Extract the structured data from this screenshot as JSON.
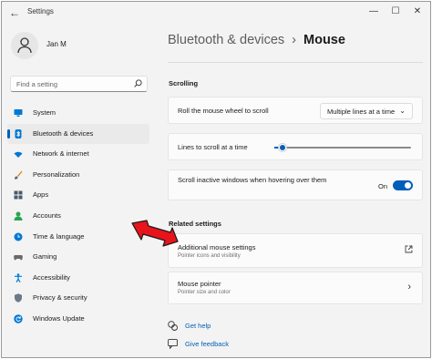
{
  "window": {
    "title": "Settings",
    "controls": {
      "minimize": "—",
      "maximize": "☐",
      "close": "✕"
    }
  },
  "user": {
    "name": "Jan M"
  },
  "search": {
    "placeholder": "Find a setting"
  },
  "sidebar": {
    "items": [
      {
        "label": "System",
        "icon": "monitor-icon",
        "color": "#0078d4",
        "active": false
      },
      {
        "label": "Bluetooth & devices",
        "icon": "bluetooth-icon",
        "color": "#0078d4",
        "active": true
      },
      {
        "label": "Network & internet",
        "icon": "wifi-icon",
        "color": "#0078d4",
        "active": false
      },
      {
        "label": "Personalization",
        "icon": "paintbrush-icon",
        "color": "#e08a2a",
        "active": false
      },
      {
        "label": "Apps",
        "icon": "apps-icon",
        "color": "#4a5a6a",
        "active": false
      },
      {
        "label": "Accounts",
        "icon": "person-icon",
        "color": "#2aa44f",
        "active": false
      },
      {
        "label": "Time & language",
        "icon": "globe-clock-icon",
        "color": "#0078d4",
        "active": false
      },
      {
        "label": "Gaming",
        "icon": "gamepad-icon",
        "color": "#6a6a6a",
        "active": false
      },
      {
        "label": "Accessibility",
        "icon": "accessibility-icon",
        "color": "#0078d4",
        "active": false
      },
      {
        "label": "Privacy & security",
        "icon": "shield-icon",
        "color": "#6a7a8a",
        "active": false
      },
      {
        "label": "Windows Update",
        "icon": "update-icon",
        "color": "#0078d4",
        "active": false
      }
    ]
  },
  "breadcrumb": {
    "parent": "Bluetooth & devices",
    "separator": "›",
    "current": "Mouse"
  },
  "scrolling": {
    "heading": "Scrolling",
    "roll_label": "Roll the mouse wheel to scroll",
    "roll_value": "Multiple lines at a time",
    "lines_label": "Lines to scroll at a time",
    "lines_slider_fraction": 0.06,
    "inactive_label": "Scroll inactive windows when hovering over them",
    "inactive_state": "On",
    "inactive_on": true
  },
  "related": {
    "heading": "Related settings",
    "items": [
      {
        "title": "Additional mouse settings",
        "subtitle": "Pointer icons and visibility",
        "icon": "external-link-icon"
      },
      {
        "title": "Mouse pointer",
        "subtitle": "Pointer size and color",
        "icon": "chevron-right-icon"
      }
    ]
  },
  "help": {
    "get_help": "Get help",
    "give_feedback": "Give feedback"
  },
  "colors": {
    "accent": "#005fb8",
    "annotation_arrow": "#e8141b"
  }
}
